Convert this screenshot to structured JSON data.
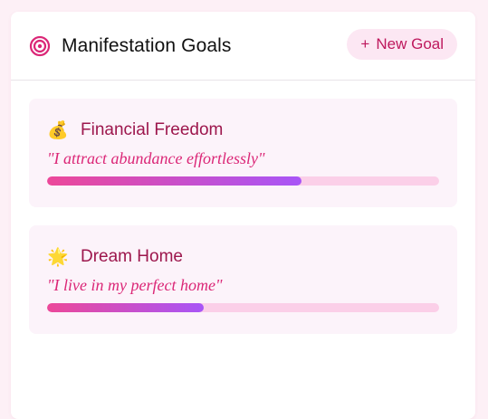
{
  "panel": {
    "title": "Manifestation Goals",
    "title_icon": "target-icon",
    "new_goal_plus": "+",
    "new_goal_label": "New Goal"
  },
  "goals": [
    {
      "icon": "money-bag-icon",
      "emoji": "💰",
      "title": "Financial Freedom",
      "affirmation": "\"I attract abundance effortlessly\"",
      "progress": 0.65
    },
    {
      "icon": "sun-icon",
      "emoji": "🌟",
      "title": "Dream Home",
      "affirmation": "\"I live in my perfect home\"",
      "progress": 0.4
    }
  ],
  "colors": {
    "accent": "#be185d",
    "title_pink": "#9d174d",
    "affirmation_pink": "#db2777",
    "progress_start": "#ec4899",
    "progress_end": "#a855f7",
    "progress_track": "#fbcfe8",
    "card_bg": "#fcf3fa",
    "button_bg": "#fce7f3"
  }
}
